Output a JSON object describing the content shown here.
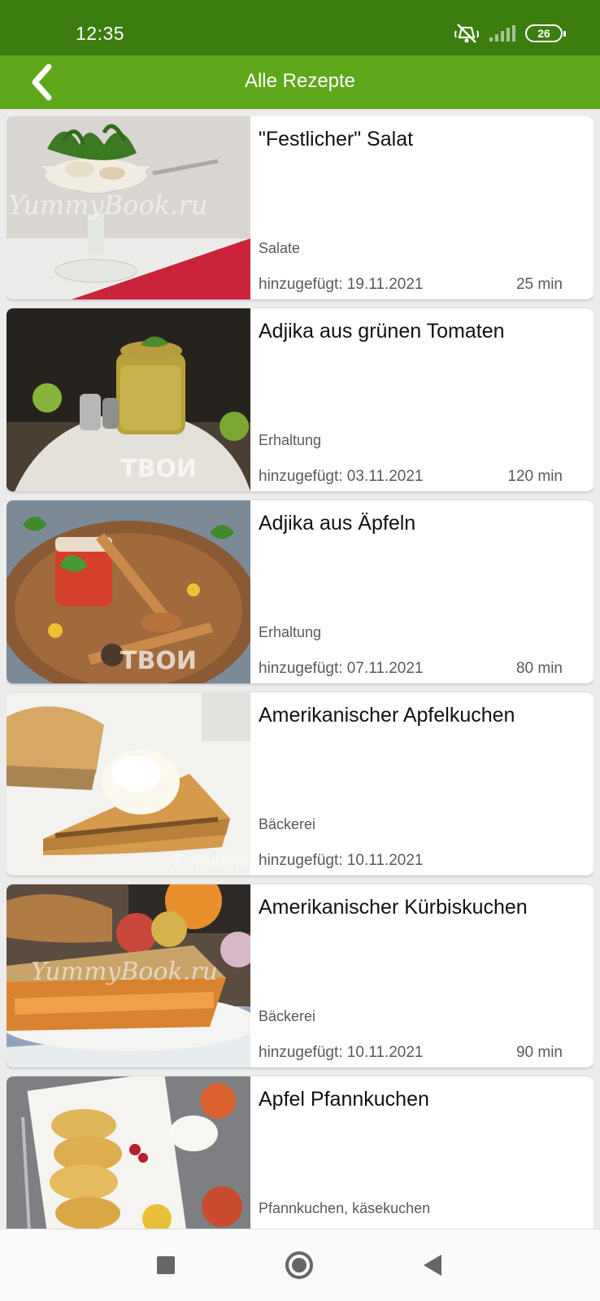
{
  "status_bar": {
    "time": "12:35",
    "icons": [
      "mute-icon",
      "signal-icon",
      "battery-icon"
    ],
    "battery_level": "26"
  },
  "app_bar": {
    "title": "Alle Rezepte",
    "back_icon": "chevron-left-icon"
  },
  "colors": {
    "status_bar": "#3b7d0f",
    "app_bar": "#5ea81a"
  },
  "recipes": [
    {
      "title": "\"Festlicher\" Salat",
      "category": "Salate",
      "added": "hinzugefügt: 19.11.2021",
      "duration": "25 min",
      "watermark": "YummyBook.ru"
    },
    {
      "title": "Adjika aus grünen Tomaten",
      "category": "Erhaltung",
      "added": "hinzugefügt: 03.11.2021",
      "duration": "120 min",
      "watermark": "ТВОИ"
    },
    {
      "title": "Adjika aus Äpfeln",
      "category": "Erhaltung",
      "added": "hinzugefügt: 07.11.2021",
      "duration": "80 min",
      "watermark": "ТВОИ"
    },
    {
      "title": "Amerikanischer Apfelkuchen",
      "category": "Bäckerei",
      "added": "hinzugefügt: 10.11.2021",
      "duration": "",
      "watermark": "Kamelena"
    },
    {
      "title": "Amerikanischer Kürbiskuchen",
      "category": "Bäckerei",
      "added": "hinzugefügt: 10.11.2021",
      "duration": "90 min",
      "watermark": "YummyBook.ru"
    },
    {
      "title": "Apfel Pfannkuchen",
      "category": "Pfannkuchen, käsekuchen",
      "added": "",
      "duration": ""
    }
  ],
  "nav_bar": {
    "icons": [
      "recents-icon",
      "home-icon",
      "back-icon"
    ]
  }
}
